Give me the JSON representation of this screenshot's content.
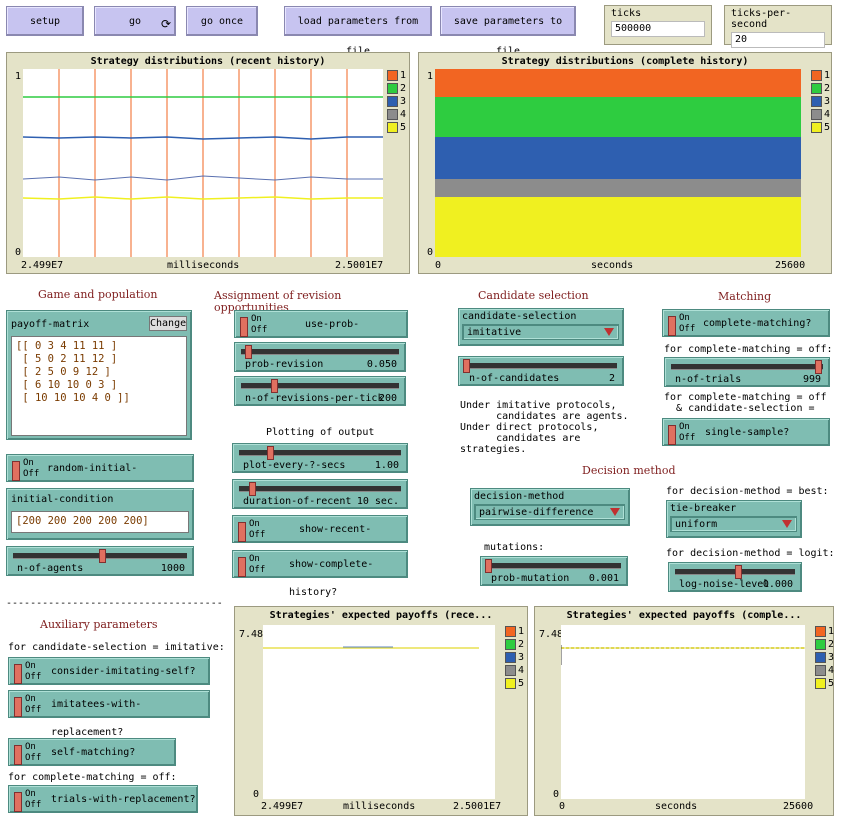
{
  "buttons": {
    "setup": "setup",
    "go": "go",
    "go_once": "go once",
    "load": "load parameters from file",
    "save": "save parameters to file"
  },
  "monitors": {
    "ticks_label": "ticks",
    "ticks_value": "500000",
    "tps_label": "ticks-per-second",
    "tps_value": "20"
  },
  "plot_recent": {
    "title": "Strategy distributions (recent history)",
    "ymax": "1",
    "ymin": "0",
    "xmin": "2.499E7",
    "xmax": "2.5001E7",
    "xlabel": "milliseconds"
  },
  "plot_complete": {
    "title": "Strategy distributions (complete history)",
    "ymax": "1",
    "ymin": "0",
    "xmin": "0",
    "xmax": "25600",
    "xlabel": "seconds"
  },
  "legend": [
    "1",
    "2",
    "3",
    "4",
    "5"
  ],
  "colors": [
    "#f26522",
    "#2ecc40",
    "#2e5fb0",
    "#8c8c8c",
    "#f0f020"
  ],
  "headings": {
    "game": "Game and population",
    "revision": "Assignment of revision opportunities",
    "plotting": "Plotting of output",
    "candidate": "Candidate selection",
    "matching": "Matching",
    "decision": "Decision method",
    "auxiliary": "Auxiliary parameters",
    "divider": "------------------------------------"
  },
  "payoff": {
    "label": "payoff-matrix",
    "change": "Change",
    "rows": [
      "[[ 0 3 4 11 11 ]",
      " [ 5 0 2 11 12 ]",
      " [ 2 5 0 9 12 ]",
      " [ 6 10 10 0 3 ]",
      " [ 10 10 10 4 0 ]]"
    ]
  },
  "switches": {
    "on": "On",
    "off": "Off",
    "random_initial": "random-initial-condition?",
    "use_prob_revision": "use-prob-revision?",
    "show_recent": "show-recent-history?",
    "show_complete": "show-complete-history?",
    "complete_matching": "complete-matching?",
    "single_sample": "single-sample?",
    "consider_imitating_self": "consider-imitating-self?",
    "imitatees_with_replacement": "imitatees-with-replacement?",
    "self_matching": "self-matching?",
    "trials_with_replacement": "trials-with-replacement?"
  },
  "initial_condition": {
    "label": "initial-condition",
    "value": "[200 200 200 200 200]"
  },
  "sliders": {
    "n_of_agents": {
      "name": "n-of-agents",
      "value": "1000",
      "level": 0.45
    },
    "prob_revision": {
      "name": "prob-revision",
      "value": "0.050",
      "level": 0.05
    },
    "n_revisions": {
      "name": "n-of-revisions-per-tick",
      "value": "200",
      "level": 0.2
    },
    "plot_every": {
      "name": "plot-every-?-secs",
      "value": "1.00",
      "level": 0.2
    },
    "duration_recent": {
      "name": "duration-of-recent",
      "value": "10 sec.",
      "level": 0.08
    },
    "n_candidates": {
      "name": "n-of-candidates",
      "value": "2",
      "level": 0.02
    },
    "n_trials": {
      "name": "n-of-trials",
      "value": "999",
      "level": 1.0
    },
    "prob_mutation": {
      "name": "prob-mutation",
      "value": "0.001",
      "level": 0.01
    },
    "log_noise": {
      "name": "log-noise-level",
      "value": "0.000",
      "level": 0.55
    }
  },
  "choosers": {
    "candidate_selection": {
      "name": "candidate-selection",
      "value": "imitative"
    },
    "decision_method": {
      "name": "decision-method",
      "value": "pairwise-difference"
    },
    "tie_breaker": {
      "name": "tie-breaker",
      "value": "uniform"
    }
  },
  "notes": {
    "candidate_note": [
      "Under imitative protocols,",
      "      candidates are agents.",
      "Under direct protocols,",
      "      candidates are",
      "strategies."
    ],
    "complete_off": "for complete-matching = off:",
    "complete_off_cand": [
      "for complete-matching = off",
      "  & candidate-selection ="
    ],
    "dm_best": "for decision-method = best:",
    "dm_logit": "for decision-method = logit:",
    "mutations": "mutations:",
    "cs_imitative": "for candidate-selection = imitative:",
    "complete_off2": "for complete-matching = off:"
  },
  "plot_payoff_recent": {
    "title": "Strategies' expected payoffs (rece...",
    "ymax": "7.48",
    "ymin": "0",
    "xmin": "2.499E7",
    "xmax": "2.5001E7",
    "xlabel": "milliseconds"
  },
  "plot_payoff_complete": {
    "title": "Strategies' expected payoffs (comple...",
    "ymax": "7.48",
    "ymin": "0",
    "xmin": "0",
    "xmax": "25600",
    "xlabel": "seconds"
  },
  "chart_data": [
    {
      "type": "area",
      "title": "Strategy distributions (recent history)",
      "xlabel": "milliseconds",
      "xlim": [
        24990000,
        25001000
      ],
      "ylim": [
        0,
        1
      ],
      "series": [
        {
          "name": "1",
          "values": [
            0.0
          ]
        },
        {
          "name": "2",
          "values": [
            0.19
          ]
        },
        {
          "name": "3",
          "values": [
            0.2
          ]
        },
        {
          "name": "4",
          "values": [
            0.1
          ]
        },
        {
          "name": "5",
          "values": [
            0.31
          ]
        }
      ]
    },
    {
      "type": "area",
      "title": "Strategy distributions (complete history)",
      "xlabel": "seconds",
      "xlim": [
        0,
        25600
      ],
      "ylim": [
        0,
        1
      ],
      "series": [
        {
          "name": "1",
          "values": [
            0.16
          ]
        },
        {
          "name": "2",
          "values": [
            0.23
          ]
        },
        {
          "name": "3",
          "values": [
            0.2
          ]
        },
        {
          "name": "4",
          "values": [
            0.09
          ]
        },
        {
          "name": "5",
          "values": [
            0.32
          ]
        }
      ]
    },
    {
      "type": "line",
      "title": "Strategies' expected payoffs (rece...",
      "xlabel": "milliseconds",
      "ylim": [
        0,
        7.48
      ],
      "series": [
        {
          "name": "5",
          "values": [
            6.5
          ]
        }
      ]
    },
    {
      "type": "line",
      "title": "Strategies' expected payoffs (comple...",
      "xlabel": "seconds",
      "ylim": [
        0,
        7.48
      ],
      "series": [
        {
          "name": "5",
          "values": [
            6.5
          ]
        }
      ]
    }
  ]
}
